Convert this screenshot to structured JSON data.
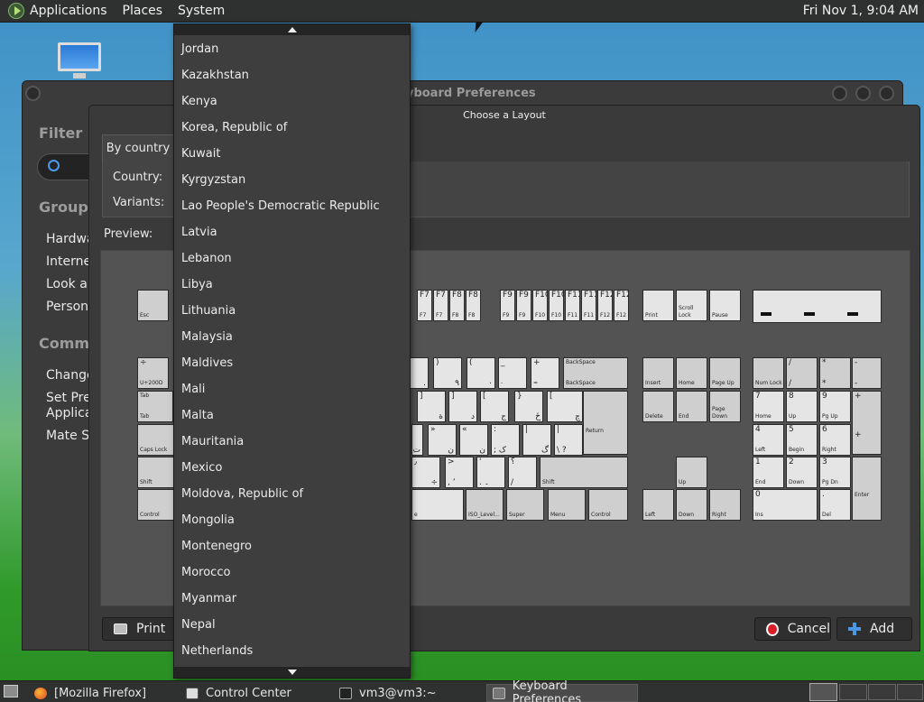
{
  "top_panel": {
    "menus": [
      "Applications",
      "Places",
      "System"
    ],
    "clock": "Fri Nov 1, 9:04 AM"
  },
  "keyboard_preferences": {
    "title": "Keyboard Preferences",
    "filter_label": "Filter",
    "groups_label": "Groups",
    "groups": [
      "Hardware",
      "Internet",
      "Look and",
      "Personal"
    ],
    "common_label": "Common",
    "common_items": [
      "Change",
      "Set Pref",
      "Applicat",
      "Mate Sys"
    ]
  },
  "choose_layout": {
    "title": "Choose a Layout",
    "tab_label": "By country",
    "country_label": "Country:",
    "variants_label": "Variants:",
    "preview_label": "Preview:",
    "print_label": "Print",
    "cancel_label": "Cancel",
    "add_label": "Add"
  },
  "country_dropdown": {
    "items": [
      "Jordan",
      "Kazakhstan",
      "Kenya",
      "Korea, Republic of",
      "Kuwait",
      "Kyrgyzstan",
      "Lao People's Democratic Republic",
      "Latvia",
      "Lebanon",
      "Libya",
      "Lithuania",
      "Malaysia",
      "Maldives",
      "Mali",
      "Malta",
      "Mauritania",
      "Mexico",
      "Moldova, Republic of",
      "Mongolia",
      "Montenegro",
      "Morocco",
      "Myanmar",
      "Nepal",
      "Netherlands"
    ]
  },
  "keyboard": {
    "esc": "Esc",
    "fkeys": [
      "F7",
      "F8",
      "F9",
      "F10",
      "F11",
      "F12"
    ],
    "print": "Print",
    "scroll_lock": "Scroll Lock",
    "pause": "Pause",
    "backspace": "BackSpace",
    "insert": "Insert",
    "home": "Home",
    "page_up": "Page Up",
    "delete": "Delete",
    "end": "End",
    "page_down": "Page Down",
    "num_lock": "Num Lock",
    "tab": "Tab",
    "caps_lock": "Caps Lock",
    "shift": "Shift",
    "control": "Control",
    "return": "Return",
    "super": "Super",
    "menu": "Menu",
    "iso_level": "ISO_Level...",
    "up": "Up",
    "left": "Left",
    "down": "Down",
    "right": "Right",
    "enter": "Enter",
    "u2007": "U+200D",
    "kp_7": "7",
    "kp_7b": "Home",
    "kp_8": "8",
    "kp_8b": "Up",
    "kp_9": "9",
    "kp_9b": "Pg Up",
    "kp_4": "4",
    "kp_4b": "Left",
    "kp_5": "5",
    "kp_5b": "Begin",
    "kp_6": "6",
    "kp_6b": "Right",
    "kp_1": "1",
    "kp_1b": "End",
    "kp_2": "2",
    "kp_2b": "Down",
    "kp_3": "3",
    "kp_3b": "Pg Dn",
    "kp_0": "0",
    "kp_0b": "Ins",
    "kp_dot": ".",
    "kp_dotb": "Del"
  },
  "taskbar": {
    "tasks": [
      "[Mozilla Firefox]",
      "Control Center",
      "vm3@vm3:~",
      "Keyboard Preferences"
    ]
  }
}
